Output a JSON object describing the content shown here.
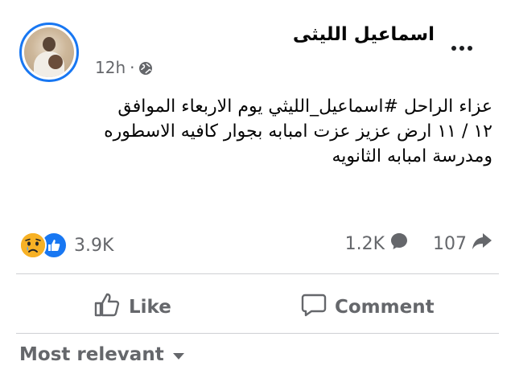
{
  "post": {
    "author": "اسماعيل الليثى",
    "timestamp": "12h",
    "separator": "·",
    "privacy_icon": "globe-icon",
    "text_lines": [
      "عزاء الراحل #اسماعيل_الليثي يوم الاربعاء الموافق",
      "١٢ / ١١ ارض عزيز عزت امبابه بجوار كافيه الاسطوره",
      "ومدرسة امبابه الثانويه"
    ]
  },
  "reactions": {
    "icons": [
      "sad-reaction-icon",
      "like-reaction-icon"
    ],
    "count": "3.9K"
  },
  "stats": {
    "comments": "1.2K",
    "shares": "107"
  },
  "actions": {
    "like_label": "Like",
    "comment_label": "Comment"
  },
  "sort": {
    "label": "Most relevant"
  },
  "colors": {
    "accent": "#1877f2",
    "secondary_text": "#65676b",
    "sad_reaction": "#f7b125",
    "divider": "#ced0d4"
  }
}
